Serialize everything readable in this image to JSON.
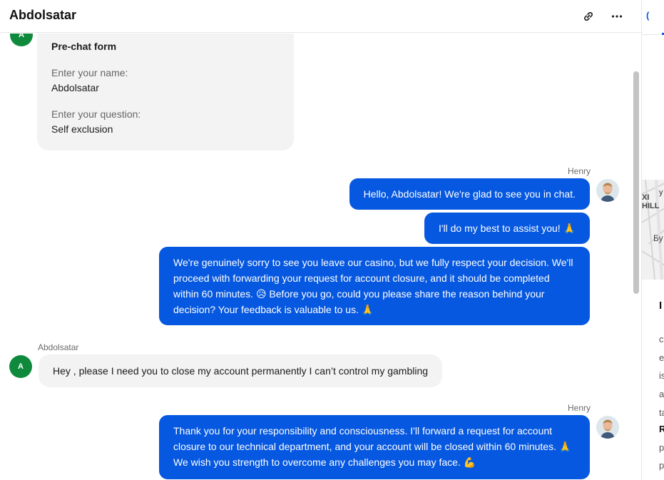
{
  "header": {
    "title": "Abdolsatar",
    "link_icon": "link-icon",
    "more_icon": "more-horizontal-icon"
  },
  "prechat": {
    "avatar_letter": "A",
    "title": "Pre-chat form",
    "name_label": "Enter your name:",
    "name_value": "Abdolsatar",
    "question_label": "Enter your question:",
    "question_value": "Self exclusion"
  },
  "messages": [
    {
      "sender": "Henry",
      "bubbles": [
        "Hello, Abdolsatar! We're glad to see you in chat.",
        "I'll do my best to assist you! 🙏",
        "We're genuinely sorry to see you leave our casino, but we fully respect your decision. We'll proceed with forwarding your request for account closure, and it should be completed within 60 minutes. 😥 Before you go, could you please share the reason behind your decision? Your feedback is valuable to us. 🙏"
      ]
    },
    {
      "sender": "Abdolsatar",
      "avatar_letter": "A",
      "bubbles": [
        "Hey , please I need you to close my account permanently I can’t control my gambling"
      ]
    },
    {
      "sender": "Henry",
      "bubbles": [
        "Thank you for your responsibility and consciousness. I'll forward a request for account closure to our technical department, and your account will be closed within 60 minutes. 🙏 We wish you strength to overcome any challenges you may face. 💪"
      ]
    }
  ],
  "side_panel": {
    "tab_initial": "(",
    "map_text_1": "у",
    "map_text_2": "ХI",
    "map_text_3": "HILL",
    "map_text_4": "Бу",
    "section_initial": "I",
    "letters": [
      "c",
      "e",
      "is",
      "a",
      "ta",
      "R",
      "p",
      "p"
    ]
  },
  "colors": {
    "agent_bubble": "#0658e0",
    "visitor_bubble": "#f3f3f3",
    "visitor_avatar": "#0f8a3c"
  }
}
